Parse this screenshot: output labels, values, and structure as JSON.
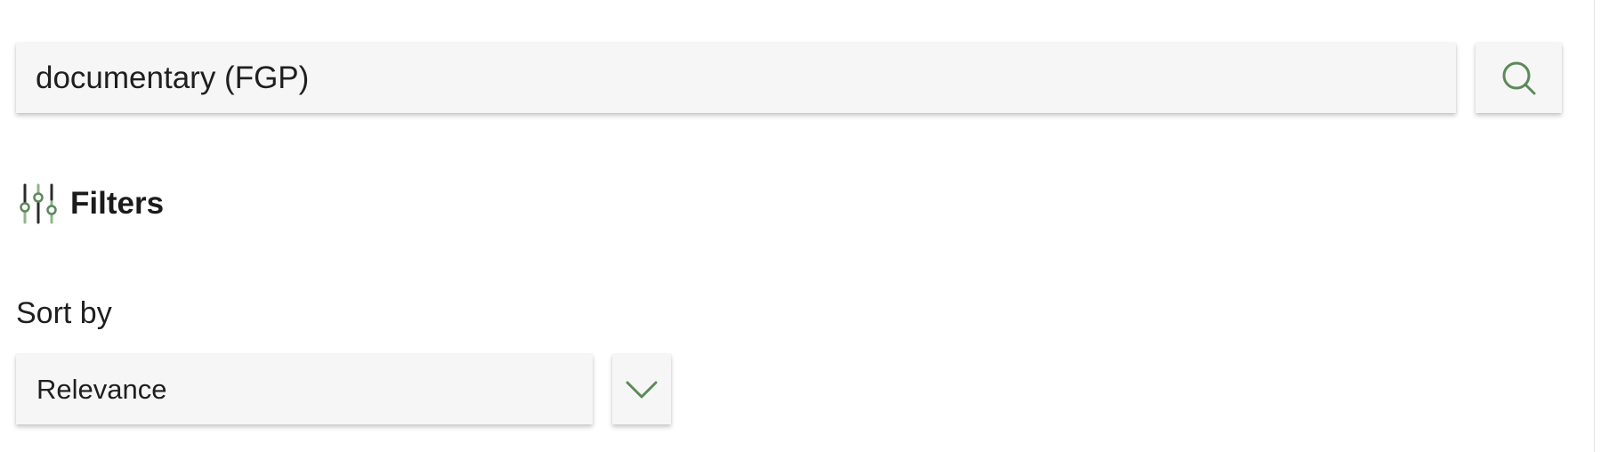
{
  "search": {
    "value": "documentary (FGP)",
    "button_icon": "search-icon"
  },
  "filters": {
    "label": "Filters",
    "icon": "sliders-icon"
  },
  "sort": {
    "label": "Sort by",
    "selected": "Relevance",
    "toggle_icon": "chevron-down-icon"
  },
  "colors": {
    "accent": "#5b8a58",
    "accent_light": "#8fb58a",
    "field_background": "#f6f6f6",
    "text": "#1b1b1b"
  }
}
